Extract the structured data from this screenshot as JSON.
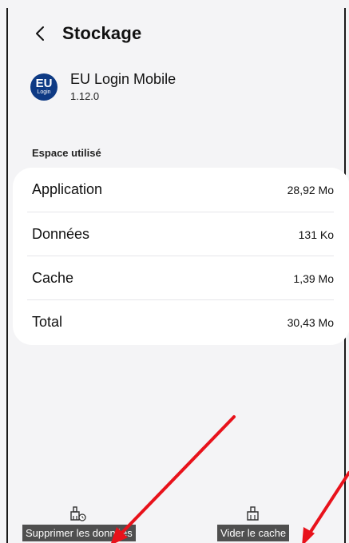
{
  "header": {
    "title": "Stockage",
    "back_icon": "chevron-left-icon"
  },
  "app": {
    "logo_text_top": "EU",
    "logo_text_bottom": "Login",
    "name": "EU Login Mobile",
    "version": "1.12.0",
    "logo_color": "#0e3a84"
  },
  "storage": {
    "section_label": "Espace utilisé",
    "rows": [
      {
        "label": "Application",
        "value": "28,92 Mo"
      },
      {
        "label": "Données",
        "value": "131 Ko"
      },
      {
        "label": "Cache",
        "value": "1,39 Mo"
      },
      {
        "label": "Total",
        "value": "30,43 Mo"
      }
    ]
  },
  "actions": {
    "clear_data_label": "Supprimer les données",
    "clear_data_icon": "broom-clear-data-icon",
    "clear_cache_label": "Vider le cache",
    "clear_cache_icon": "broom-icon"
  },
  "annotations": {
    "arrow_color": "#e8121b"
  }
}
